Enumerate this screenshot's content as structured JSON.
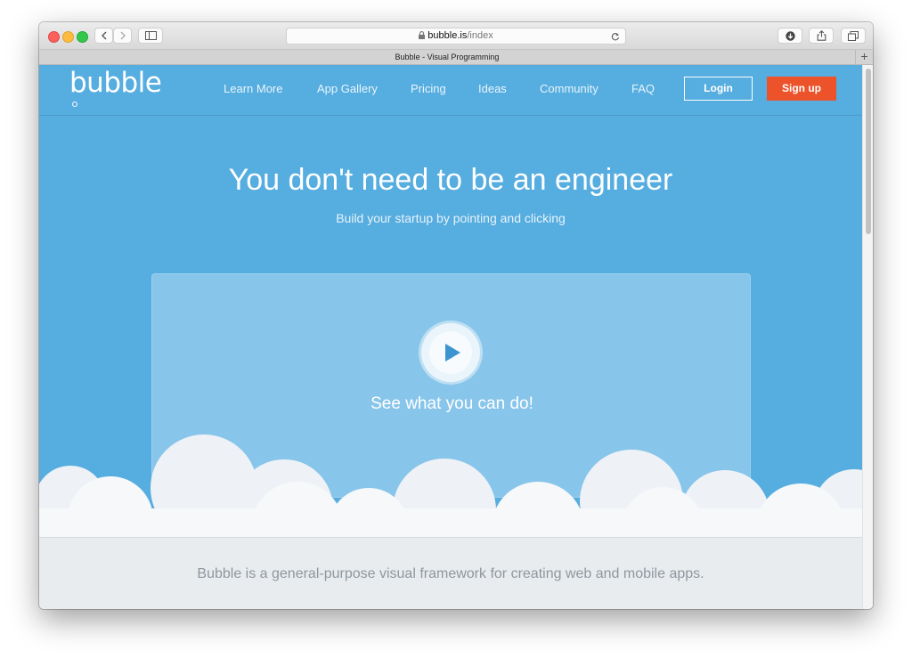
{
  "browser": {
    "url_domain": "bubble.is",
    "url_path": "/index",
    "tab_title": "Bubble - Visual Programming",
    "new_tab_glyph": "+"
  },
  "site": {
    "logo": "bubble",
    "nav": [
      {
        "label": "Learn More"
      },
      {
        "label": "App Gallery"
      },
      {
        "label": "Pricing"
      },
      {
        "label": "Ideas"
      },
      {
        "label": "Community"
      },
      {
        "label": "FAQ"
      }
    ],
    "login_label": "Login",
    "signup_label": "Sign up",
    "headline": "You don't need to be an engineer",
    "subheadline": "Build your startup by pointing and clicking",
    "video_cta": "See what you can do!",
    "tagline": "Bubble is a general-purpose visual framework for creating web and mobile apps."
  },
  "colors": {
    "brand_blue": "#56addf",
    "signup_orange": "#ec532b",
    "cloud_white": "#f6f8fa"
  }
}
